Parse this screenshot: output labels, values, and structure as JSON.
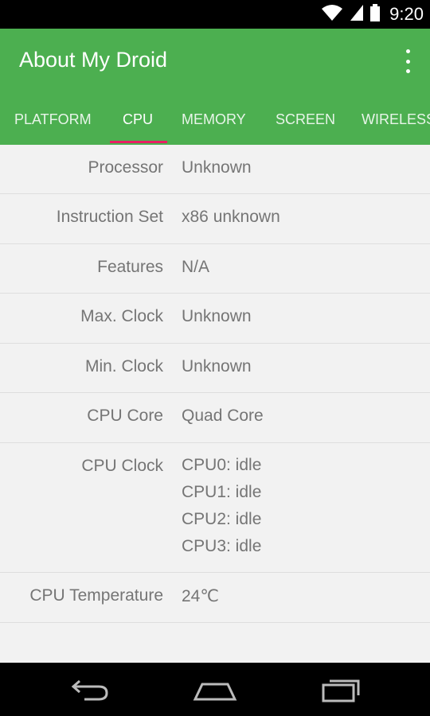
{
  "status_bar": {
    "time": "9:20",
    "icons": [
      "wifi-icon",
      "signal-icon",
      "battery-icon"
    ]
  },
  "app_bar": {
    "title": "About My Droid",
    "menu_icon": "overflow-menu-icon"
  },
  "tabs": [
    {
      "label": "PLATFORM",
      "active": false
    },
    {
      "label": "CPU",
      "active": true
    },
    {
      "label": "MEMORY",
      "active": false
    },
    {
      "label": "SCREEN",
      "active": false
    },
    {
      "label": "WIRELESS",
      "active": false
    }
  ],
  "cpu_info": {
    "processor": {
      "label": "Processor",
      "value": "Unknown"
    },
    "instruction_set": {
      "label": "Instruction Set",
      "value": "x86 unknown"
    },
    "features": {
      "label": "Features",
      "value": "N/A"
    },
    "max_clock": {
      "label": "Max. Clock",
      "value": "Unknown"
    },
    "min_clock": {
      "label": "Min. Clock",
      "value": "Unknown"
    },
    "cpu_core": {
      "label": "CPU Core",
      "value": "Quad Core"
    },
    "cpu_clock": {
      "label": "CPU Clock",
      "values": [
        "CPU0: idle",
        "CPU1: idle",
        "CPU2: idle",
        "CPU3: idle"
      ]
    },
    "cpu_temperature": {
      "label": "CPU Temperature",
      "value": "24℃"
    }
  },
  "colors": {
    "app_bar": "#4caf50",
    "tab_indicator": "#e91e63",
    "content_bg": "#f2f2f2",
    "text": "#757575"
  },
  "nav_bar": {
    "icons": [
      "back-icon",
      "home-icon",
      "recents-icon"
    ]
  }
}
